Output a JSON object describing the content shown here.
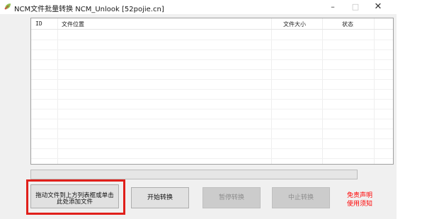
{
  "window": {
    "title": "NCM文件批量转换 NCM_Unlook [52pojie.cn]",
    "icon": "app-leaf-icon",
    "controls": {
      "minimize": "–",
      "maximize": "□",
      "close": "✕"
    }
  },
  "file_list": {
    "columns": [
      "ID",
      "文件位置",
      "文件大小",
      "状态"
    ],
    "rows": []
  },
  "progress": {
    "value": 0,
    "fill_color": "#06b025"
  },
  "drop_hint": {
    "line1": "拖动文件到上方列表框或单击",
    "line2": "此处添加文件",
    "highlight_color": "#e0201b"
  },
  "buttons": {
    "start": "开始转换",
    "pause": "暂停转换",
    "stop": "中止转换"
  },
  "links": {
    "disclaimer": "免责声明",
    "notice": "使用须知",
    "color": "#ff0000"
  }
}
